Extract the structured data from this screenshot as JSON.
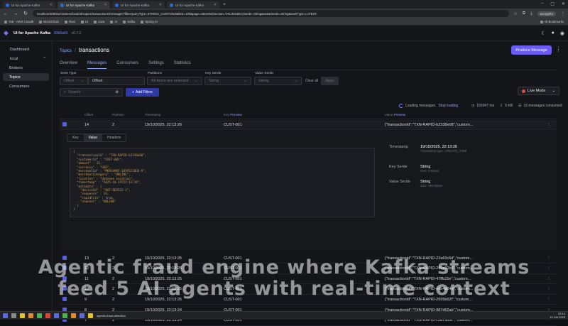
{
  "browser": {
    "tabs": [
      {
        "label": "UI for Apache Kafka",
        "active": false
      },
      {
        "label": "UI for Apache Kafka",
        "active": true
      },
      {
        "label": "UI for Apache Kafka",
        "active": false
      },
      {
        "label": "UI for Apache Kafka",
        "active": false
      }
    ],
    "url": "localhost:8080/ui/clusters/local/all-topics/transactions/messages?filterQueryType=STRING_CONTAINS&limit=100&page=0&seekDirection=TAILING&keySerde=String&valueSerde=String&seekType=LATEST",
    "incognito_label": "Incognito",
    "bookmarks": [
      "Yo6 - AWS Cloud9",
      "BlockChain",
      "Rust",
      "UI",
      "Java",
      "AI",
      "Kafka",
      "Spring AI"
    ],
    "all_bookmarks": "All Bookmarks"
  },
  "app": {
    "title": "UI for Apache Kafka",
    "version_hash": "83b5a60",
    "version": "v0.7.2"
  },
  "sidebar": {
    "dashboard": "Dashboard",
    "cluster": "local",
    "items": [
      "Brokers",
      "Topics",
      "Consumers"
    ]
  },
  "breadcrumb": {
    "parent": "Topics",
    "current": "transactions"
  },
  "produce_button": "Produce Message",
  "tabs": [
    "Overview",
    "Messages",
    "Consumers",
    "Settings",
    "Statistics"
  ],
  "filters": {
    "seek_type_label": "Seek Type",
    "seek_type_value": "Offset",
    "offset_placeholder": "Offset",
    "partitions_label": "Partitions",
    "partitions_value": "All items are selected.",
    "key_serde_label": "Key Serde",
    "key_serde_value": "String",
    "value_serde_label": "Value Serde",
    "value_serde_value": "String",
    "clear_all": "Clear all",
    "apply": "Apply",
    "search_placeholder": "Search",
    "add_filters": "Add Filters",
    "live_mode": "Live Mode"
  },
  "status": {
    "loading": "Loading messages.",
    "stop_loading": "Stop loading",
    "ms": "155047 ms",
    "size": "5 KB",
    "consumed": "15 messages consumed"
  },
  "columns": {
    "offset": "Offset",
    "partition": "Partition",
    "timestamp": "Timestamp",
    "key": "Key",
    "key_preview": "Preview",
    "value": "Value",
    "value_preview": "Preview"
  },
  "selected_row": {
    "offset": "14",
    "partition": "2",
    "timestamp": "19/10/2025, 22:13:26",
    "key": "CUST-001",
    "value": "{\"transactionId\":\"TXN-RAPID-b2338e08\",\"custom..."
  },
  "detail": {
    "tabs": [
      "Key",
      "Value",
      "Headers"
    ],
    "json_lines": [
      "{",
      "  \"transactionId\" : \"TXN-RAPID-b2338e08\",",
      "  \"customerId\" : \"CUST-001\",",
      "  \"amount\" : 15,",
      "  \"currency\" : \"USD\",",
      "  \"merchantId\" : \"MERCHANT-SUSPICIOUS-9\",",
      "  \"merchantCategory\" : \"ONLINE\",",
      "  \"location\" : \"Unknown Location\",",
      "  \"timestamp\" : \"2025-10-19T22:13:26\",",
      "  \"metadata\" : {",
      "    \"deviceId\" : \"BOT-DEVICE-3\",",
      "    \"sequence\" : 14,",
      "    \"rapidFire\" : true,",
      "    \"channel\" : \"ONLINE\"",
      "  }",
      "}"
    ],
    "timestamp_label": "Timestamp",
    "timestamp_value": "19/10/2025, 22:13:26",
    "timestamp_sub": "Timestamp type: CREATE_TIME",
    "key_serde_label": "Key Serde",
    "key_serde_value": "String",
    "key_serde_size": "Size: 8 Bytes",
    "value_serde_label": "Value Serde",
    "value_serde_value": "String",
    "value_serde_size": "Size: 308 Bytes"
  },
  "rows": [
    {
      "offset": "13",
      "partition": "2",
      "timestamp": "19/10/2025, 22:13:25",
      "key": "CUST-001",
      "value": "{\"transactionId\":\"TXN-RAPID-22a63c6d\",\"custom..."
    },
    {
      "offset": "12",
      "partition": "2",
      "timestamp": "19/10/2025, 22:13:25",
      "key": "CUST-001",
      "value": "{\"transactionId\":\"TXN-RAPID-249e92b6\",\"custom..."
    },
    {
      "offset": "11",
      "partition": "2",
      "timestamp": "19/10/2025, 22:13:25",
      "key": "CUST-001",
      "value": "{\"transactionId\":\"TXN-RAPID-47ffb15e\",\"custom..."
    },
    {
      "offset": "10",
      "partition": "2",
      "timestamp": "19/10/2025, 22:13:25",
      "key": "CUST-001",
      "value": "{\"transactionId\":\"TXN-RAPID-edb4d84e\",\"custom..."
    },
    {
      "offset": "9",
      "partition": "2",
      "timestamp": "19/10/2025, 22:13:25",
      "key": "CUST-001",
      "value": "{\"transactionId\":\"TXN-RAPID-2695b62f\",\"custom..."
    },
    {
      "offset": "8",
      "partition": "2",
      "timestamp": "19/10/2025, 22:13:24",
      "key": "CUST-001",
      "value": "{\"transactionId\":\"TXN-RAPID-987d52ab\",\"custom..."
    },
    {
      "offset": "7",
      "partition": "2",
      "timestamp": "19/10/2025, 22:13:24",
      "key": "CUST-001",
      "value": "{\"transactionId\":\"TXN-RAPID-c5a79b3c\",\"custom..."
    }
  ],
  "caption": {
    "line1": "Agentic fraud engine where Kafka streams",
    "line2": "feed 5 AI agents with real-time context"
  },
  "taskbar": {
    "window_label": "agentic-fraud-detection",
    "time": "22:14",
    "date": "19 Oct 2025"
  }
}
